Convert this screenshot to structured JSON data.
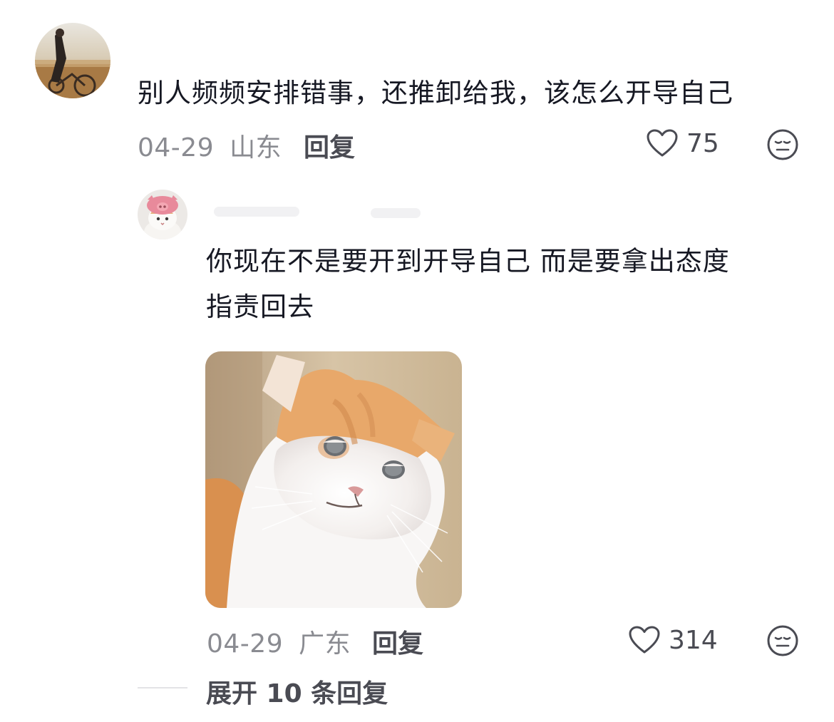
{
  "comments": [
    {
      "text": "别人频频安排错事，还推卸给我，该怎么开导自己",
      "date": "04-29",
      "location": "山东",
      "reply_label": "回复",
      "likes": "75"
    }
  ],
  "replies": [
    {
      "text_line1": "你现在不是要开到开导自己 而是要拿出态度",
      "text_line2": "指责回去",
      "date": "04-29",
      "location": "广东",
      "reply_label": "回复",
      "likes": "314"
    }
  ],
  "expand_label": "展开 10 条回复",
  "icons": {
    "like": "heart-outline-icon",
    "reaction": "neutral-face-icon"
  },
  "colors": {
    "text_primary": "#161823",
    "text_secondary": "#8a8b91",
    "icon_stroke": "#4a4b53"
  }
}
